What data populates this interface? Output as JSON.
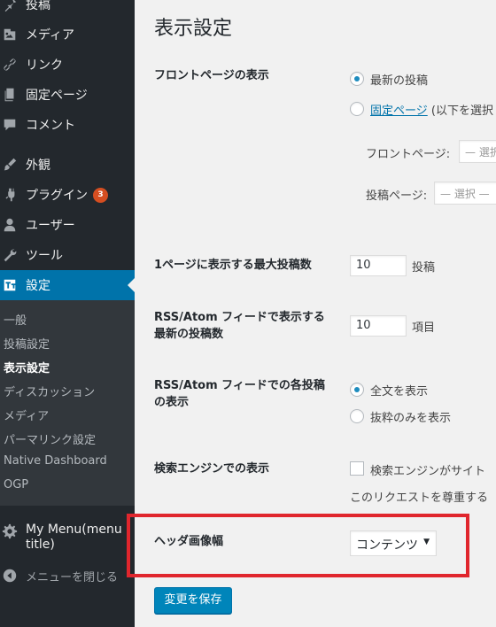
{
  "sidebar": {
    "menu": [
      {
        "label": "投稿",
        "icon": "pin-icon"
      },
      {
        "label": "メディア",
        "icon": "media-icon"
      },
      {
        "label": "リンク",
        "icon": "link-icon"
      },
      {
        "label": "固定ページ",
        "icon": "page-icon"
      },
      {
        "label": "コメント",
        "icon": "comment-icon"
      },
      {
        "label": "外観",
        "icon": "brush-icon"
      },
      {
        "label": "プラグイン",
        "icon": "plugin-icon",
        "badge": "3"
      },
      {
        "label": "ユーザー",
        "icon": "user-icon"
      },
      {
        "label": "ツール",
        "icon": "wrench-icon"
      },
      {
        "label": "設定",
        "icon": "settings-icon",
        "current": true
      }
    ],
    "submenu": [
      {
        "label": "一般"
      },
      {
        "label": "投稿設定"
      },
      {
        "label": "表示設定",
        "current": true
      },
      {
        "label": "ディスカッション"
      },
      {
        "label": "メディア"
      },
      {
        "label": "パーマリンク設定"
      },
      {
        "label": "Native Dashboard"
      },
      {
        "label": "OGP"
      }
    ],
    "custom_menu": {
      "label_line1": "My Menu(menu",
      "label_line2": "title)",
      "icon": "gear-icon"
    },
    "collapse_label": "メニューを閉じる"
  },
  "main": {
    "title": "表示設定",
    "front_page": {
      "label": "フロントページの表示",
      "option_latest": "最新の投稿",
      "option_static_link": "固定ページ",
      "option_static_rest": " (以下を選択",
      "front_label": "フロントページ:",
      "front_select": "— 選択",
      "posts_label": "投稿ページ:",
      "posts_select": "— 選択 —"
    },
    "posts_per_page": {
      "label": "1ページに表示する最大投稿数",
      "value": "10",
      "unit": "投稿"
    },
    "feed_count": {
      "label_line1": "RSS/Atom フィードで表示する",
      "label_line2": "最新の投稿数",
      "value": "10",
      "unit": "項目"
    },
    "feed_content": {
      "label_line1": "RSS/Atom フィードでの各投稿",
      "label_line2": "の表示",
      "option_full": "全文を表示",
      "option_summary": "抜粋のみを表示"
    },
    "search_engine": {
      "label": "検索エンジンでの表示",
      "checkbox_text": "検索エンジンがサイト",
      "note": "このリクエストを尊重する"
    },
    "header_width": {
      "label": "ヘッダ画像幅",
      "value": "コンテンツ"
    },
    "save_label": "変更を保存"
  },
  "colors": {
    "sidebar_bg": "#23282d",
    "accent": "#0073aa",
    "badge": "#d54e21",
    "highlight": "#e0262d"
  }
}
